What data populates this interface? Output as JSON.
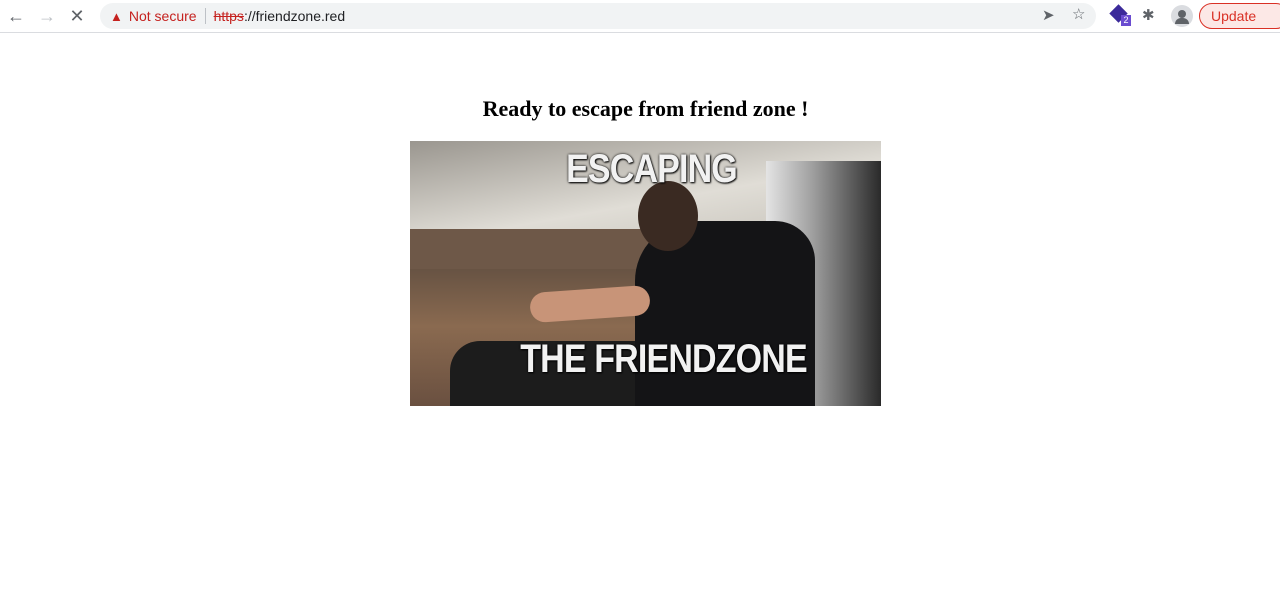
{
  "browser": {
    "security_label": "Not secure",
    "url_scheme": "https",
    "url_rest": "://friendzone.red",
    "extension_badge": "2",
    "update_label": "Update",
    "icons": [
      "back-icon",
      "forward-icon",
      "stop-icon",
      "warning-icon",
      "send-icon",
      "star-icon",
      "extension-icon",
      "puzzle-icon",
      "profile-icon",
      "menu-icon"
    ]
  },
  "page": {
    "heading": "Ready to escape from friend zone !",
    "image_caption_top": "ESCAPING",
    "image_caption_bottom": "THE  FRIENDZONE"
  }
}
